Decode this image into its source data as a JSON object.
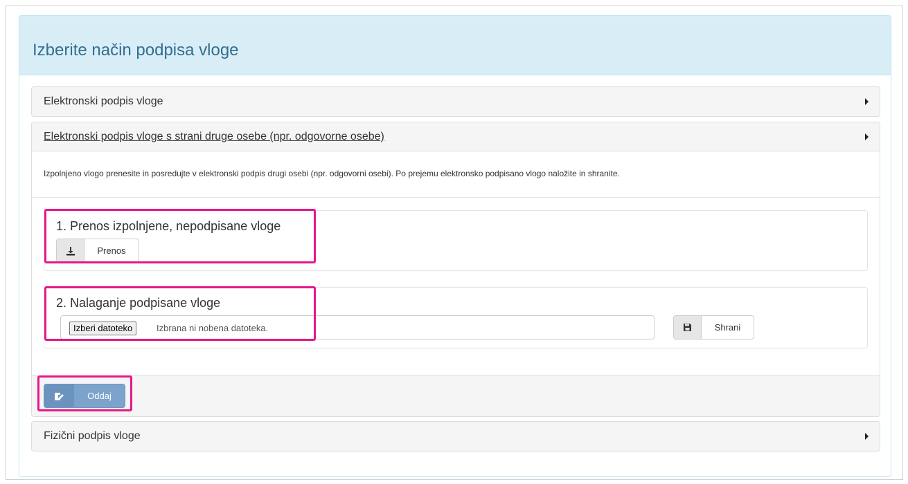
{
  "panel": {
    "title": "Izberite način podpisa vloge"
  },
  "accordion": [
    {
      "title": "Elektronski podpis vloge",
      "expanded": false
    },
    {
      "title": "Elektronski podpis vloge s strani druge osebe (npr. odgovorne osebe)",
      "expanded": true
    },
    {
      "title": "Fizični podpis vloge",
      "expanded": false
    }
  ],
  "section": {
    "description": "Izpolnjeno vlogo prenesite in posredujte v elektronski podpis drugi osebi (npr. odgovorni osebi). Po prejemu elektronsko podpisano vlogo naložite in shranite.",
    "step1": {
      "title": "1. Prenos izpolnjene, nepodpisane vloge",
      "button_label": "Prenos",
      "button_icon": "download-icon"
    },
    "step2": {
      "title": "2. Nalaganje podpisane vloge",
      "file_button": "Izberi datoteko",
      "file_status": "Izbrana ni nobena datoteka.",
      "save_label": "Shrani",
      "save_icon": "floppy-disk-icon"
    },
    "submit": {
      "label": "Oddaj",
      "icon": "edit-document-icon"
    }
  },
  "colors": {
    "heading_bg": "#d9edf7",
    "heading_text": "#31708f",
    "highlight": "#e6168a",
    "submit_bg": "#7ba3cb"
  }
}
